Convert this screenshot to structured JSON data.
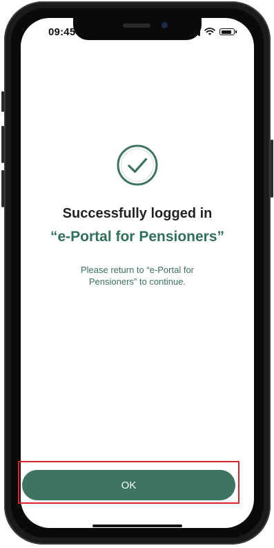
{
  "status_bar": {
    "time": "09:45"
  },
  "main": {
    "title": "Successfully logged in",
    "portal_name": "“e-Portal for Pensioners”",
    "message": "Please return to “e-Portal for Pensioners” to continue."
  },
  "actions": {
    "ok_label": "OK"
  },
  "colors": {
    "accent": "#3f7462",
    "portal_text": "#2f6f5b",
    "highlight_border": "#d6262f"
  },
  "icons": {
    "status": [
      "signal-icon",
      "wifi-icon",
      "battery-icon"
    ],
    "main": "check-circle-icon"
  }
}
